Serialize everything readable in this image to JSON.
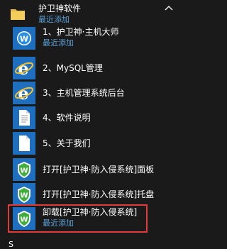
{
  "group": {
    "title": "护卫神软件",
    "subtitle": "最近添加",
    "icon": "folder-icon",
    "chevron": "chevron-up-icon"
  },
  "items": [
    {
      "label": "1、护卫神·主机大师",
      "sub": "最近添加",
      "icon": "huweishen-w-icon"
    },
    {
      "label": "2、MySQL管理",
      "sub": "",
      "icon": "internet-explorer-icon"
    },
    {
      "label": "3、主机管理系统后台",
      "sub": "",
      "icon": "internet-explorer-icon"
    },
    {
      "label": "4、软件说明",
      "sub": "",
      "icon": "document-icon"
    },
    {
      "label": "5、关于我们",
      "sub": "",
      "icon": "blank-document-icon"
    },
    {
      "label": "打开[护卫神·防入侵系统]面板",
      "sub": "",
      "icon": "huweishen-shield-icon"
    },
    {
      "label": "打开[护卫神·防入侵系统]托盘",
      "sub": "",
      "icon": "huweishen-shield-icon"
    },
    {
      "label": "卸载[护卫神·防入侵系统]",
      "sub": "最近添加",
      "icon": "huweishen-shield-icon"
    }
  ],
  "section_letter": "S",
  "colors": {
    "background": "#1a1a1a",
    "tile": "#1e6fbf",
    "accent_text": "#5aa0d8",
    "highlight_border": "#e23a3a"
  }
}
